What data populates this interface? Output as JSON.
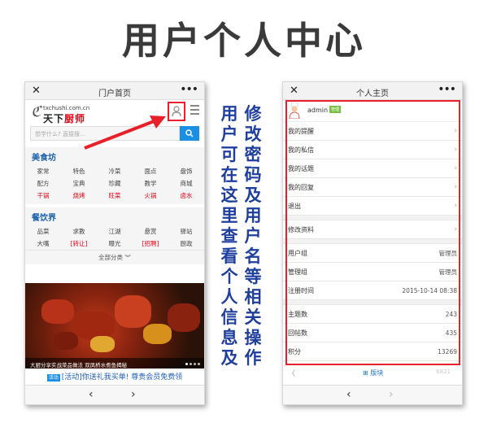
{
  "page_title": "用户个人中心",
  "left_phone": {
    "title": "门户首页",
    "close": "✕",
    "more": "•••",
    "logo_small": "txchushi.com.cn",
    "logo_text_a": "天下",
    "logo_text_b": "厨师",
    "search_placeholder": "想学什么? 直接搜...",
    "sections": [
      {
        "title": "美食坊",
        "rows": [
          [
            "家常",
            "特色",
            "冷菜",
            "面点",
            "盘饰"
          ],
          [
            "配方",
            "宝典",
            "珍藏",
            "教学",
            "商城"
          ],
          [
            "干锅",
            "烧烤",
            "旺菜",
            "火锅",
            "卤水"
          ]
        ]
      },
      {
        "title": "餐饮界",
        "rows": [
          [
            "品菜",
            "求教",
            "江湖",
            "悬赏",
            "驿站"
          ],
          [
            "大嘴",
            "[转让]",
            "曝光",
            "[招聘]",
            "厨政"
          ]
        ]
      }
    ],
    "all_categories": "全部分类 ︾",
    "banner_caption": "大厨分享实战菜品做法 双凤桥水煮鱼揭秘",
    "promo_tag": "活动",
    "promo_text": "[活动]你送礼我买单! 尊贵会员免费领",
    "nav_prev": "‹",
    "nav_next": "›"
  },
  "right_phone": {
    "title": "个人主页",
    "close": "✕",
    "more": "•••",
    "username": "admin",
    "user_badge": "管理",
    "menu_items": [
      "我的提醒",
      "我的私信",
      "我的话题",
      "我的回复",
      "退出"
    ],
    "edit_item": "修改资料",
    "info_group1": [
      {
        "label": "用户组",
        "value": "管理员"
      },
      {
        "label": "管理组",
        "value": "管理员"
      },
      {
        "label": "注册时间",
        "value": "2015-10-14 08:38"
      }
    ],
    "info_group2": [
      {
        "label": "主题数",
        "value": "243"
      },
      {
        "label": "回帖数",
        "value": "435"
      },
      {
        "label": "积分",
        "value": "13269"
      }
    ],
    "board_prev": "〈",
    "board_label": "版块",
    "board_num": "6821",
    "nav_prev": "‹",
    "nav_next": "›"
  },
  "caption_col1": "用户可在这里查看个人信息及",
  "caption_col2": "修改密码及用户名等相关操作",
  "colors": {
    "accent_red": "#e8202a",
    "link_blue": "#1b5fb0",
    "caption_blue": "#1f3f9f",
    "search_blue": "#1a8fe3"
  }
}
